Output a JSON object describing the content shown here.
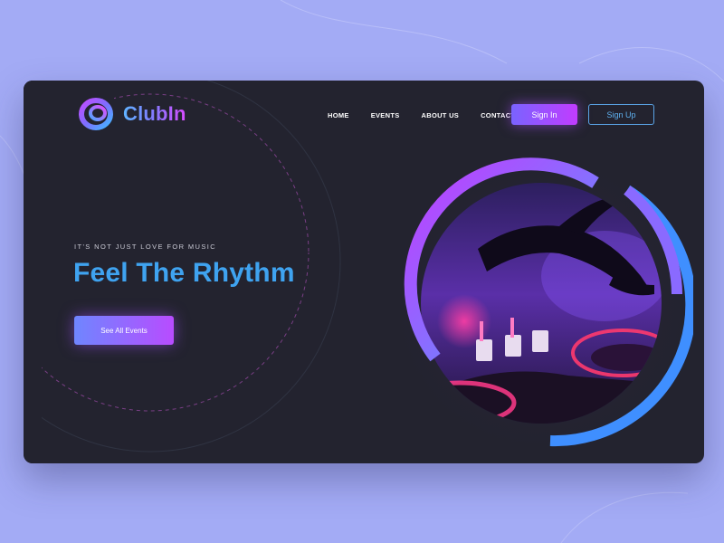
{
  "brand": {
    "name": "ClubIn",
    "logo_icon": "clubin-ring-logo"
  },
  "nav": {
    "items": [
      {
        "label": "HOME"
      },
      {
        "label": "EVENTS"
      },
      {
        "label": "ABOUT US"
      },
      {
        "label": "CONTACT"
      }
    ],
    "sign_in_label": "Sign In",
    "sign_up_label": "Sign Up"
  },
  "hero": {
    "tagline": "IT'S NOT JUST LOVE FOR MUSIC",
    "headline": "Feel The Rhythm",
    "cta_label": "See All Events",
    "image_subject": "DJ hand over mixer turntable in purple light"
  },
  "colors": {
    "page_bg": "#a3abf5",
    "card_bg": "#23232f",
    "accent_blue": "#3fa3f0",
    "accent_purple": "#b84cff"
  }
}
